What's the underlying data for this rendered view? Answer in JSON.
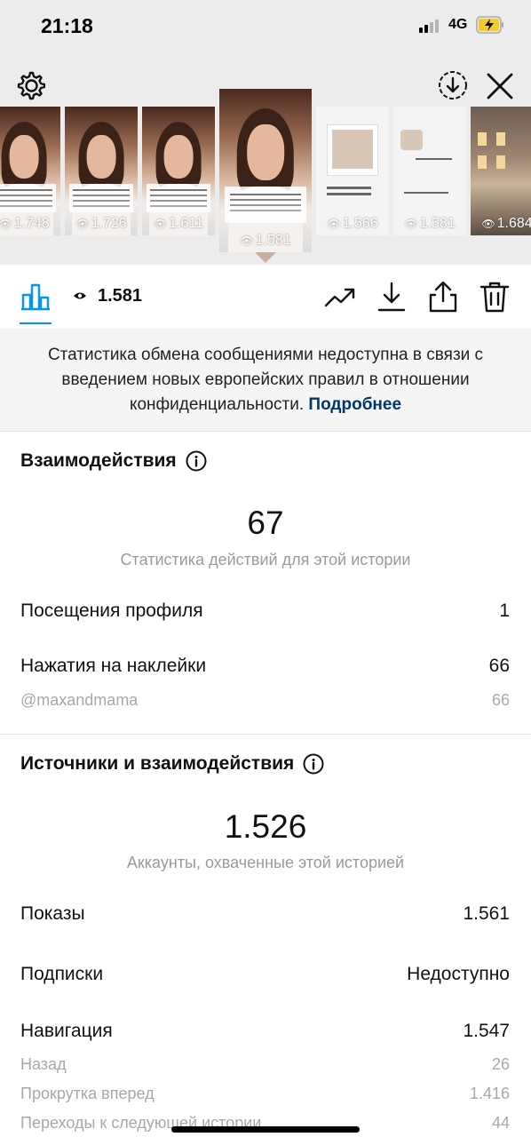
{
  "status_bar": {
    "time": "21:18",
    "network": "4G"
  },
  "thumbnails": [
    {
      "views": "1.748",
      "kind": "video"
    },
    {
      "views": "1.726",
      "kind": "video"
    },
    {
      "views": "1.611",
      "kind": "video"
    },
    {
      "views": "1.581",
      "kind": "video",
      "selected": true,
      "tag": "@MAXANDMAMA"
    },
    {
      "views": "1.566",
      "kind": "doc",
      "tag": "@MAXANDMAMA"
    },
    {
      "views": "1.581",
      "kind": "doc"
    },
    {
      "views": "1.684",
      "kind": "street"
    }
  ],
  "toolbar": {
    "views": "1.581"
  },
  "notice": {
    "text": "Статистика обмена сообщениями недоступна в связи с введением новых европейских правил в отношении конфиденциальности.",
    "link": "Подробнее"
  },
  "interactions": {
    "title": "Взаимодействия",
    "total": "67",
    "caption": "Статистика действий для этой истории",
    "rows": [
      {
        "label": "Посещения профиля",
        "value": "1"
      },
      {
        "label": "Нажатия на наклейки",
        "value": "66"
      }
    ],
    "sub_rows": [
      {
        "label": "@maxandmama",
        "value": "66"
      }
    ]
  },
  "sources": {
    "title": "Источники и взаимодействия",
    "total": "1.526",
    "caption": "Аккаунты, охваченные этой историей",
    "rows": [
      {
        "label": "Показы",
        "value": "1.561"
      },
      {
        "label": "Подписки",
        "value": "Недоступно"
      },
      {
        "label": "Навигация",
        "value": "1.547"
      }
    ],
    "sub_rows": [
      {
        "label": "Назад",
        "value": "26"
      },
      {
        "label": "Прокрутка вперед",
        "value": "1.416"
      },
      {
        "label": "Переходы к следующей истории",
        "value": "44"
      }
    ]
  },
  "colors": {
    "accent": "#0095f6",
    "link": "#00376b",
    "muted": "#9a9a9a"
  }
}
